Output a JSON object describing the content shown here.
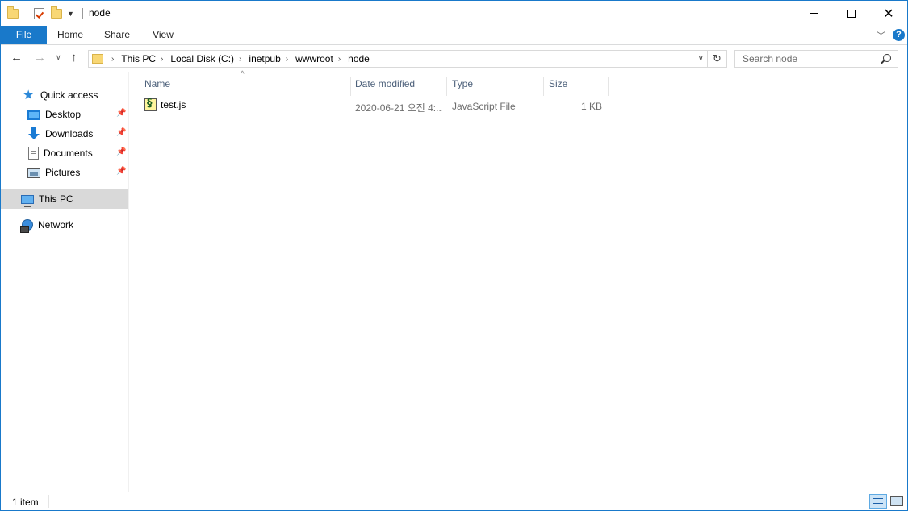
{
  "window": {
    "title": "node"
  },
  "ribbon": {
    "tabs": [
      {
        "label": "File"
      },
      {
        "label": "Home"
      },
      {
        "label": "Share"
      },
      {
        "label": "View"
      }
    ],
    "help_label": "?"
  },
  "address": {
    "crumbs": [
      "This PC",
      "Local Disk (C:)",
      "inetpub",
      "wwwroot",
      "node"
    ]
  },
  "search": {
    "placeholder": "Search node",
    "value": ""
  },
  "navpane": {
    "quick_access": "Quick access",
    "items": [
      {
        "label": "Desktop",
        "icon": "desktop-icon",
        "pinned": true
      },
      {
        "label": "Downloads",
        "icon": "downloads-icon",
        "pinned": true
      },
      {
        "label": "Documents",
        "icon": "documents-icon",
        "pinned": true
      },
      {
        "label": "Pictures",
        "icon": "pictures-icon",
        "pinned": true
      }
    ],
    "this_pc": "This PC",
    "network": "Network"
  },
  "columns": [
    {
      "label": "Name"
    },
    {
      "label": "Date modified"
    },
    {
      "label": "Type"
    },
    {
      "label": "Size"
    }
  ],
  "files": [
    {
      "name": "test.js",
      "date_modified": "2020-06-21 오전 4:...",
      "type": "JavaScript File",
      "size": "1 KB",
      "icon": "javascript-file-icon"
    }
  ],
  "status": {
    "item_count": "1 item"
  },
  "colors": {
    "accent": "#1979ca",
    "selected_nav": "#d9d9d9",
    "column_header_text": "#4c607a",
    "secondary_text": "#6d6d6d"
  }
}
